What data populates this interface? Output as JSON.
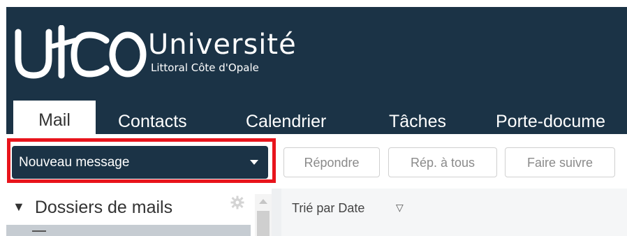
{
  "brand": {
    "name": "Université",
    "tagline": "Littoral Côte d'Opale",
    "logo_text": "ulco"
  },
  "nav": {
    "tabs": [
      {
        "label": "Mail",
        "active": true
      },
      {
        "label": "Contacts",
        "active": false
      },
      {
        "label": "Calendrier",
        "active": false
      },
      {
        "label": "Tâches",
        "active": false
      },
      {
        "label": "Porte-docume",
        "active": false
      }
    ]
  },
  "toolbar": {
    "new_message_label": "Nouveau message",
    "reply_label": "Répondre",
    "reply_all_label": "Rép. à tous",
    "forward_label": "Faire suivre"
  },
  "folders": {
    "title": "Dossiers de mails",
    "collapse_icon": "triangle-down-icon",
    "settings_icon": "gear-icon"
  },
  "message_list": {
    "sort_label": "Trié par Date",
    "sort_icon": "filter-triangle-icon"
  },
  "colors": {
    "header_bg": "#1b3346",
    "highlight": "#e8141c"
  }
}
